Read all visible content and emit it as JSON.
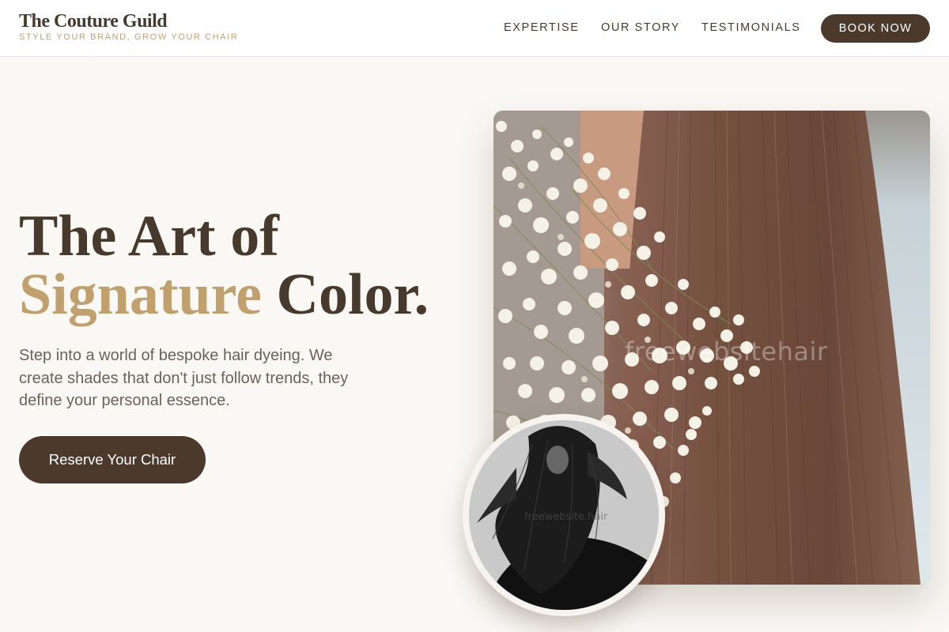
{
  "brand": {
    "name": "The Couture Guild",
    "tagline": "STYLE YOUR BRAND, GROW YOUR CHAIR"
  },
  "nav": {
    "items": [
      {
        "label": "EXPERTISE"
      },
      {
        "label": "OUR STORY"
      },
      {
        "label": "TESTIMONIALS"
      }
    ],
    "book_label": "BOOK NOW"
  },
  "hero": {
    "title_line1": "The Art of",
    "title_highlight": "Signature",
    "title_rest": " Color.",
    "description": "Step into a world of bespoke hair dyeing. We create shades that don't just follow trends, they define your personal essence.",
    "cta_label": "Reserve Your Chair"
  },
  "images": {
    "main_watermark": "freewebsitehair",
    "portrait_watermark": "freewebsite.hair"
  },
  "colors": {
    "accent_gold": "#c0a06c",
    "brand_dark": "#4b3a2c",
    "background": "#faf8f5"
  }
}
